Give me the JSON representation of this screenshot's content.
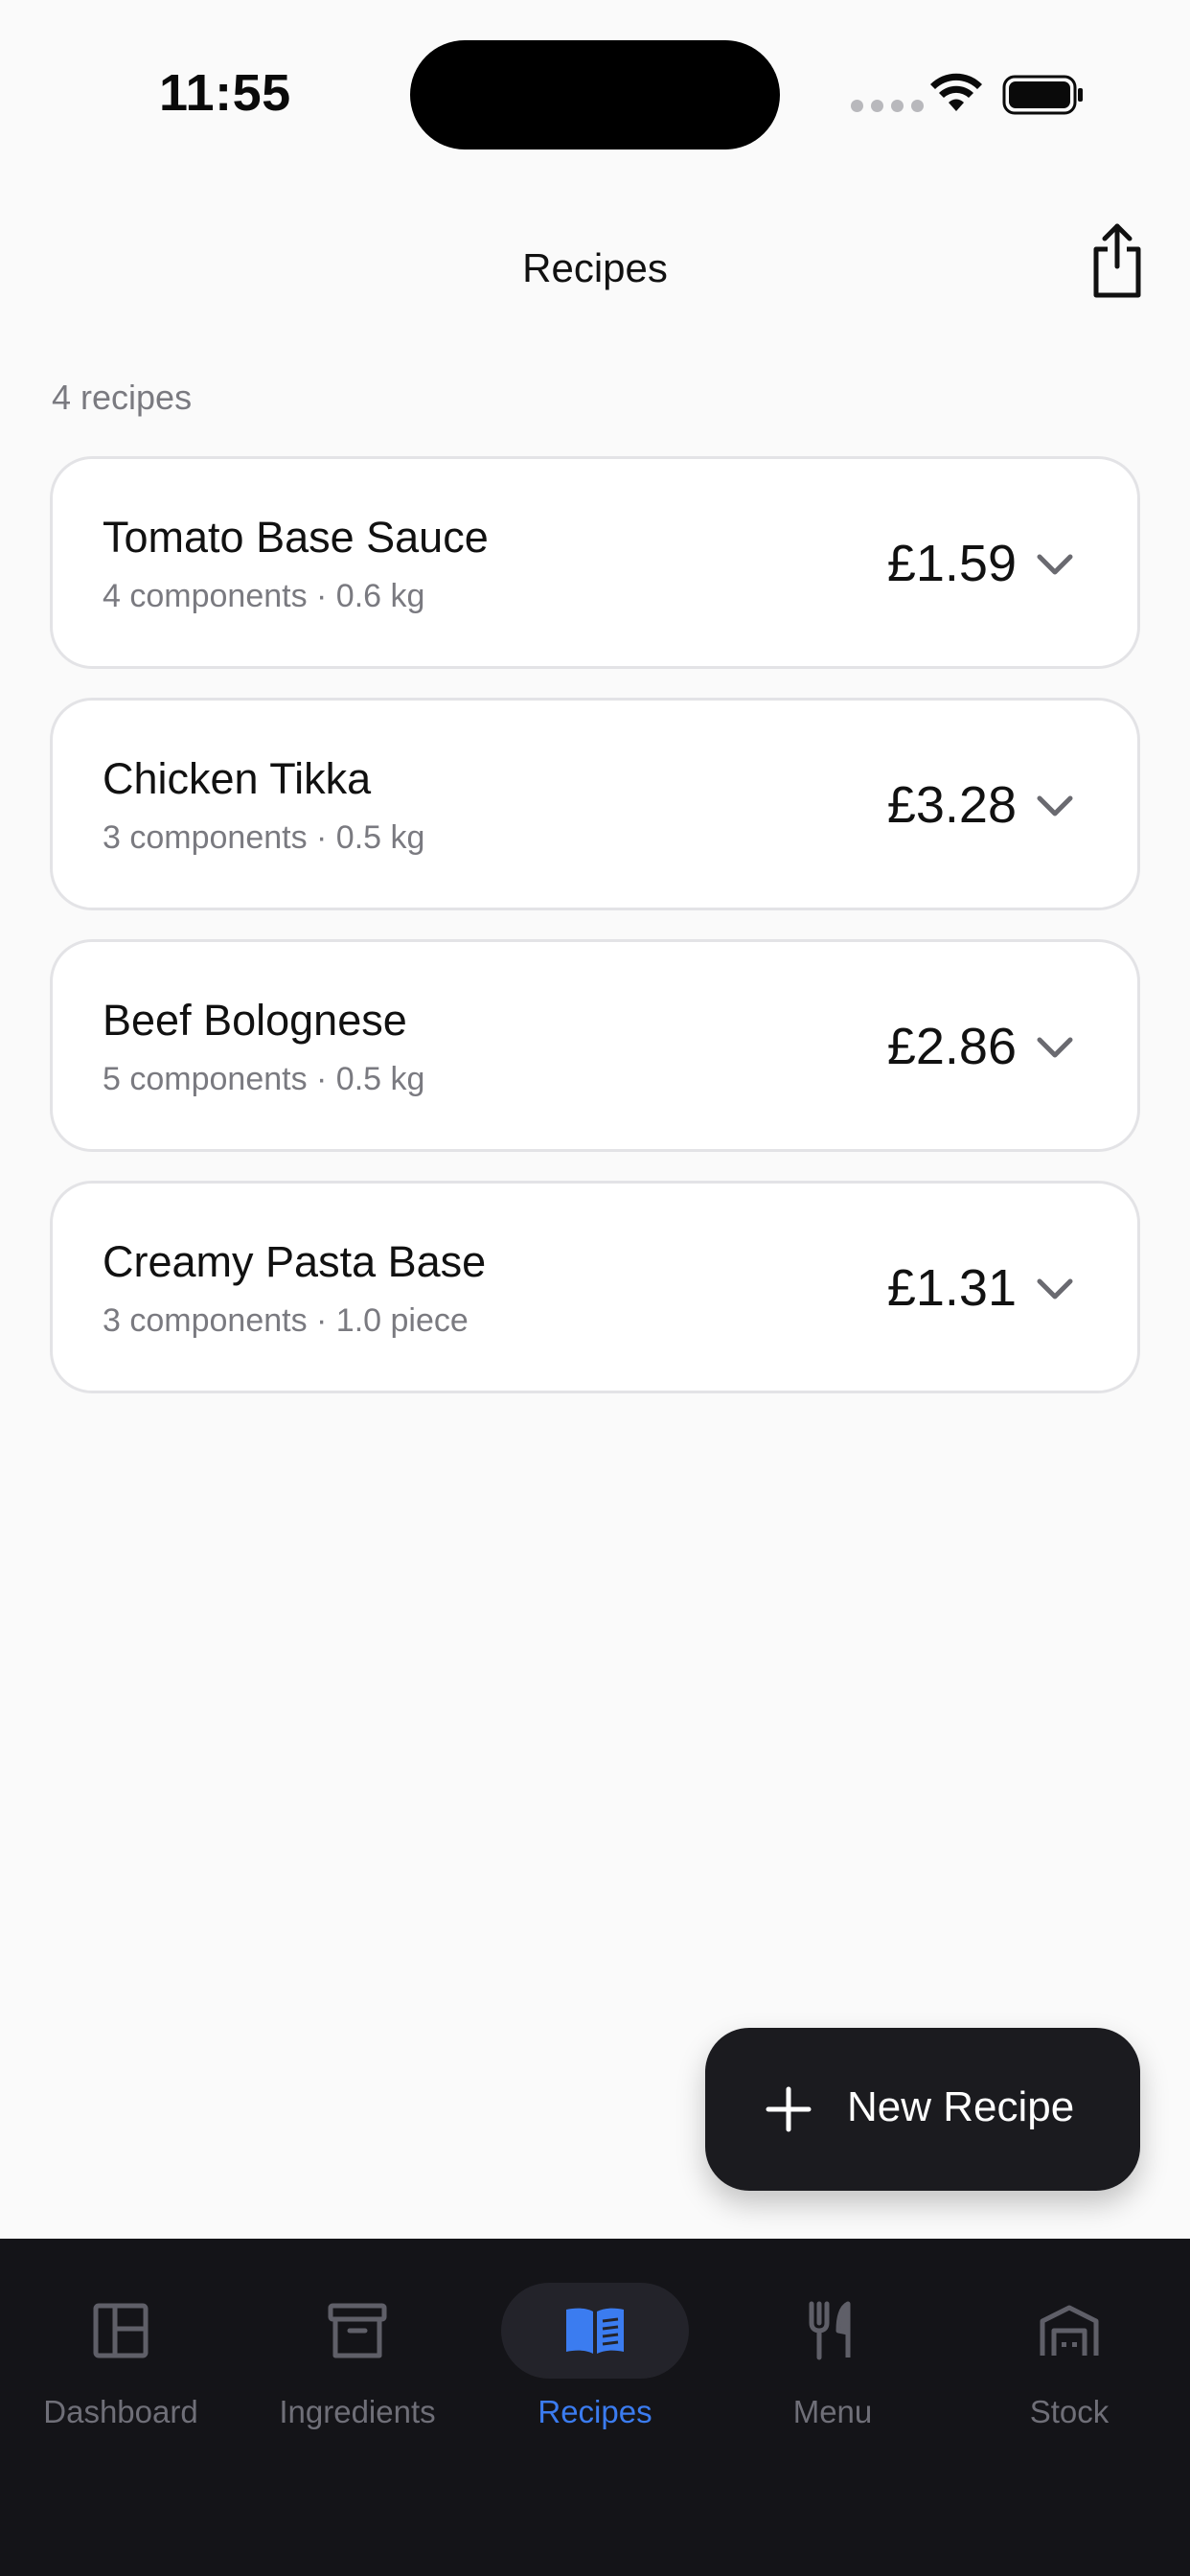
{
  "status_bar": {
    "time": "11:55"
  },
  "header": {
    "title": "Recipes",
    "share_icon": "share-icon"
  },
  "summary": {
    "count_text": "4 recipes"
  },
  "recipes": [
    {
      "name": "Tomato Base Sauce",
      "meta": "4 components · 0.6 kg",
      "price": "£1.59"
    },
    {
      "name": "Chicken Tikka",
      "meta": "3 components · 0.5 kg",
      "price": "£3.28"
    },
    {
      "name": "Beef Bolognese",
      "meta": "5 components · 0.5 kg",
      "price": "£2.86"
    },
    {
      "name": "Creamy Pasta Base",
      "meta": "3 components · 1.0 piece",
      "price": "£1.31"
    }
  ],
  "fab": {
    "label": "New Recipe",
    "icon": "plus-icon"
  },
  "tabs": [
    {
      "label": "Dashboard",
      "icon": "dashboard-icon",
      "active": false
    },
    {
      "label": "Ingredients",
      "icon": "archive-box-icon",
      "active": false
    },
    {
      "label": "Recipes",
      "icon": "open-book-icon",
      "active": true
    },
    {
      "label": "Menu",
      "icon": "fork-knife-icon",
      "active": false
    },
    {
      "label": "Stock",
      "icon": "warehouse-icon",
      "active": false
    }
  ],
  "colors": {
    "accent": "#3b7cf0",
    "tab_bar_bg": "#141418",
    "fab_bg": "#1b1b1f",
    "page_bg": "#fafafa",
    "muted_text": "#7a7a80"
  }
}
